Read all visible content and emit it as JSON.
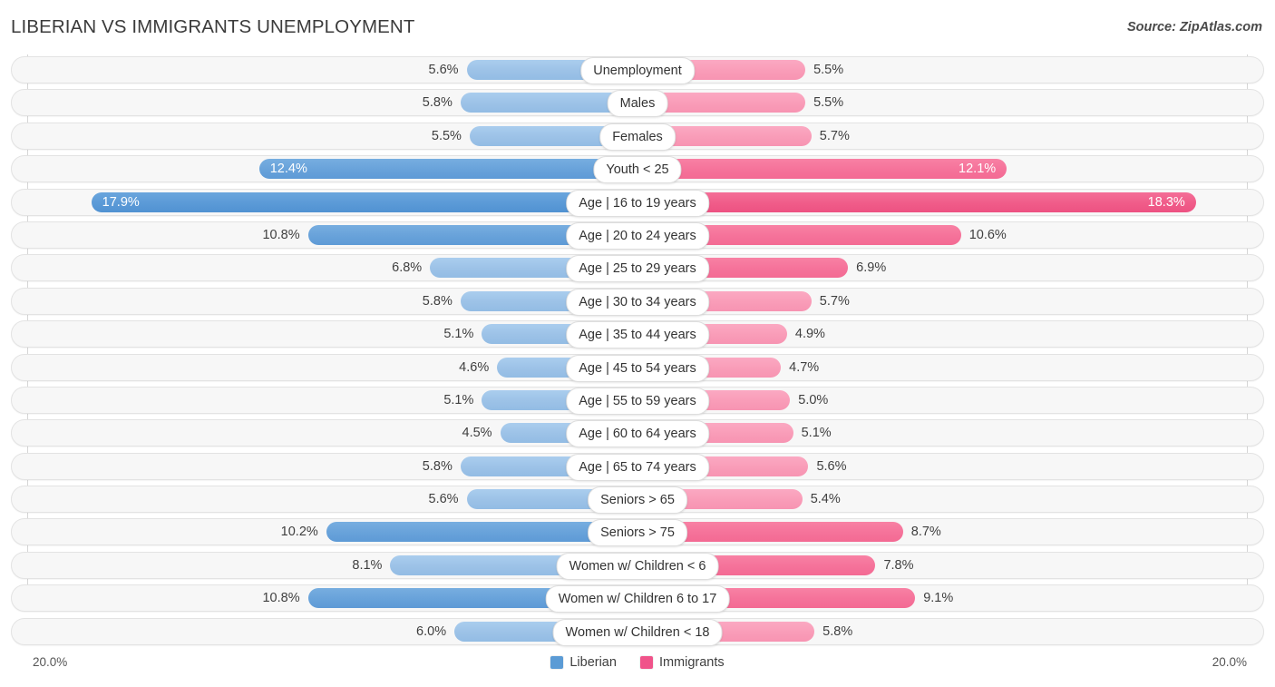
{
  "header": {
    "title": "LIBERIAN VS IMMIGRANTS UNEMPLOYMENT",
    "source": "Source: ZipAtlas.com"
  },
  "legend": {
    "items": [
      {
        "label": "Liberian",
        "color": "#5b9bd5"
      },
      {
        "label": "Immigrants",
        "color": "#f0538a"
      }
    ]
  },
  "axis": {
    "left_label": "20.0%",
    "right_label": "20.0%",
    "max": 20.0
  },
  "chart_data": {
    "type": "bar",
    "title": "LIBERIAN VS IMMIGRANTS UNEMPLOYMENT",
    "orientation": "horizontal-diverging",
    "xlabel": "",
    "ylabel": "",
    "xlim": [
      20.0,
      20.0
    ],
    "grid": true,
    "legend_position": "bottom-center",
    "categories": [
      "Unemployment",
      "Males",
      "Females",
      "Youth < 25",
      "Age | 16 to 19 years",
      "Age | 20 to 24 years",
      "Age | 25 to 29 years",
      "Age | 30 to 34 years",
      "Age | 35 to 44 years",
      "Age | 45 to 54 years",
      "Age | 55 to 59 years",
      "Age | 60 to 64 years",
      "Age | 65 to 74 years",
      "Seniors > 65",
      "Seniors > 75",
      "Women w/ Children < 6",
      "Women w/ Children 6 to 17",
      "Women w/ Children < 18"
    ],
    "series": [
      {
        "name": "Liberian",
        "color": "#5b9bd5",
        "values": [
          5.6,
          5.8,
          5.5,
          12.4,
          17.9,
          10.8,
          6.8,
          5.8,
          5.1,
          4.6,
          5.1,
          4.5,
          5.8,
          5.6,
          10.2,
          8.1,
          10.8,
          6.0
        ]
      },
      {
        "name": "Immigrants",
        "color": "#f0538a",
        "values": [
          5.5,
          5.5,
          5.7,
          12.1,
          18.3,
          10.6,
          6.9,
          5.7,
          4.9,
          4.7,
          5.0,
          5.1,
          5.6,
          5.4,
          8.7,
          7.8,
          9.1,
          5.8
        ]
      }
    ]
  },
  "rows": [
    {
      "label": "Unemployment",
      "left": "5.6%",
      "right": "5.5%",
      "left_val": 5.6,
      "right_val": 5.5,
      "left_tone": "light",
      "right_tone": "light",
      "left_inside": false,
      "right_inside": false
    },
    {
      "label": "Males",
      "left": "5.8%",
      "right": "5.5%",
      "left_val": 5.8,
      "right_val": 5.5,
      "left_tone": "light",
      "right_tone": "light",
      "left_inside": false,
      "right_inside": false
    },
    {
      "label": "Females",
      "left": "5.5%",
      "right": "5.7%",
      "left_val": 5.5,
      "right_val": 5.7,
      "left_tone": "light",
      "right_tone": "light",
      "left_inside": false,
      "right_inside": false
    },
    {
      "label": "Youth < 25",
      "left": "12.4%",
      "right": "12.1%",
      "left_val": 12.4,
      "right_val": 12.1,
      "left_tone": "mid",
      "right_tone": "mid",
      "left_inside": true,
      "right_inside": true
    },
    {
      "label": "Age | 16 to 19 years",
      "left": "17.9%",
      "right": "18.3%",
      "left_val": 17.9,
      "right_val": 18.3,
      "left_tone": "dark",
      "right_tone": "dark",
      "left_inside": true,
      "right_inside": true
    },
    {
      "label": "Age | 20 to 24 years",
      "left": "10.8%",
      "right": "10.6%",
      "left_val": 10.8,
      "right_val": 10.6,
      "left_tone": "mid",
      "right_tone": "mid",
      "left_inside": false,
      "right_inside": false
    },
    {
      "label": "Age | 25 to 29 years",
      "left": "6.8%",
      "right": "6.9%",
      "left_val": 6.8,
      "right_val": 6.9,
      "left_tone": "light",
      "right_tone": "mid",
      "left_inside": false,
      "right_inside": false
    },
    {
      "label": "Age | 30 to 34 years",
      "left": "5.8%",
      "right": "5.7%",
      "left_val": 5.8,
      "right_val": 5.7,
      "left_tone": "light",
      "right_tone": "light",
      "left_inside": false,
      "right_inside": false
    },
    {
      "label": "Age | 35 to 44 years",
      "left": "5.1%",
      "right": "4.9%",
      "left_val": 5.1,
      "right_val": 4.9,
      "left_tone": "light",
      "right_tone": "light",
      "left_inside": false,
      "right_inside": false
    },
    {
      "label": "Age | 45 to 54 years",
      "left": "4.6%",
      "right": "4.7%",
      "left_val": 4.6,
      "right_val": 4.7,
      "left_tone": "light",
      "right_tone": "light",
      "left_inside": false,
      "right_inside": false
    },
    {
      "label": "Age | 55 to 59 years",
      "left": "5.1%",
      "right": "5.0%",
      "left_val": 5.1,
      "right_val": 5.0,
      "left_tone": "light",
      "right_tone": "light",
      "left_inside": false,
      "right_inside": false
    },
    {
      "label": "Age | 60 to 64 years",
      "left": "4.5%",
      "right": "5.1%",
      "left_val": 4.5,
      "right_val": 5.1,
      "left_tone": "light",
      "right_tone": "light",
      "left_inside": false,
      "right_inside": false
    },
    {
      "label": "Age | 65 to 74 years",
      "left": "5.8%",
      "right": "5.6%",
      "left_val": 5.8,
      "right_val": 5.6,
      "left_tone": "light",
      "right_tone": "light",
      "left_inside": false,
      "right_inside": false
    },
    {
      "label": "Seniors > 65",
      "left": "5.6%",
      "right": "5.4%",
      "left_val": 5.6,
      "right_val": 5.4,
      "left_tone": "light",
      "right_tone": "light",
      "left_inside": false,
      "right_inside": false
    },
    {
      "label": "Seniors > 75",
      "left": "10.2%",
      "right": "8.7%",
      "left_val": 10.2,
      "right_val": 8.7,
      "left_tone": "mid",
      "right_tone": "mid",
      "left_inside": false,
      "right_inside": false
    },
    {
      "label": "Women w/ Children < 6",
      "left": "8.1%",
      "right": "7.8%",
      "left_val": 8.1,
      "right_val": 7.8,
      "left_tone": "light",
      "right_tone": "mid",
      "left_inside": false,
      "right_inside": false
    },
    {
      "label": "Women w/ Children 6 to 17",
      "left": "10.8%",
      "right": "9.1%",
      "left_val": 10.8,
      "right_val": 9.1,
      "left_tone": "mid",
      "right_tone": "mid",
      "left_inside": false,
      "right_inside": false
    },
    {
      "label": "Women w/ Children < 18",
      "left": "6.0%",
      "right": "5.8%",
      "left_val": 6.0,
      "right_val": 5.8,
      "left_tone": "light",
      "right_tone": "light",
      "left_inside": false,
      "right_inside": false
    }
  ]
}
